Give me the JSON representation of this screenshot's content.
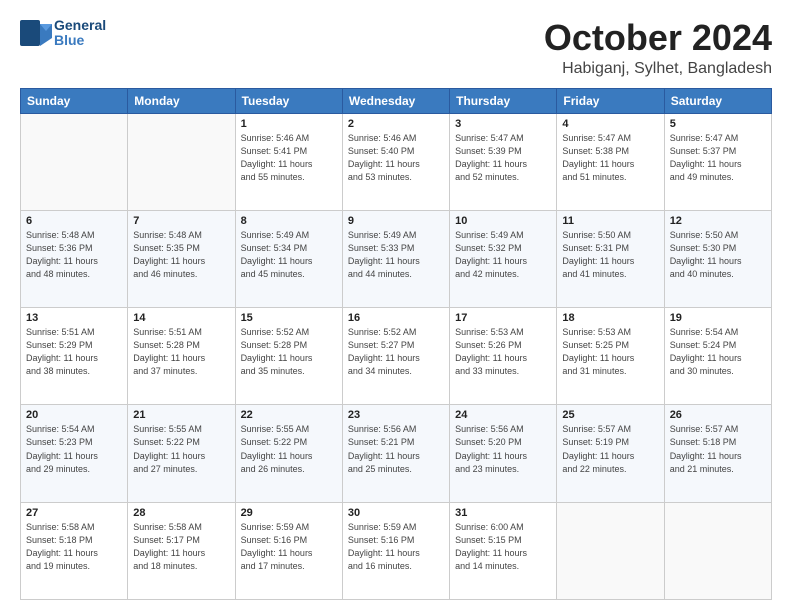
{
  "header": {
    "logo_general": "General",
    "logo_blue": "Blue",
    "month": "October 2024",
    "location": "Habiganj, Sylhet, Bangladesh"
  },
  "weekdays": [
    "Sunday",
    "Monday",
    "Tuesday",
    "Wednesday",
    "Thursday",
    "Friday",
    "Saturday"
  ],
  "weeks": [
    [
      {
        "day": "",
        "info": ""
      },
      {
        "day": "",
        "info": ""
      },
      {
        "day": "1",
        "info": "Sunrise: 5:46 AM\nSunset: 5:41 PM\nDaylight: 11 hours\nand 55 minutes."
      },
      {
        "day": "2",
        "info": "Sunrise: 5:46 AM\nSunset: 5:40 PM\nDaylight: 11 hours\nand 53 minutes."
      },
      {
        "day": "3",
        "info": "Sunrise: 5:47 AM\nSunset: 5:39 PM\nDaylight: 11 hours\nand 52 minutes."
      },
      {
        "day": "4",
        "info": "Sunrise: 5:47 AM\nSunset: 5:38 PM\nDaylight: 11 hours\nand 51 minutes."
      },
      {
        "day": "5",
        "info": "Sunrise: 5:47 AM\nSunset: 5:37 PM\nDaylight: 11 hours\nand 49 minutes."
      }
    ],
    [
      {
        "day": "6",
        "info": "Sunrise: 5:48 AM\nSunset: 5:36 PM\nDaylight: 11 hours\nand 48 minutes."
      },
      {
        "day": "7",
        "info": "Sunrise: 5:48 AM\nSunset: 5:35 PM\nDaylight: 11 hours\nand 46 minutes."
      },
      {
        "day": "8",
        "info": "Sunrise: 5:49 AM\nSunset: 5:34 PM\nDaylight: 11 hours\nand 45 minutes."
      },
      {
        "day": "9",
        "info": "Sunrise: 5:49 AM\nSunset: 5:33 PM\nDaylight: 11 hours\nand 44 minutes."
      },
      {
        "day": "10",
        "info": "Sunrise: 5:49 AM\nSunset: 5:32 PM\nDaylight: 11 hours\nand 42 minutes."
      },
      {
        "day": "11",
        "info": "Sunrise: 5:50 AM\nSunset: 5:31 PM\nDaylight: 11 hours\nand 41 minutes."
      },
      {
        "day": "12",
        "info": "Sunrise: 5:50 AM\nSunset: 5:30 PM\nDaylight: 11 hours\nand 40 minutes."
      }
    ],
    [
      {
        "day": "13",
        "info": "Sunrise: 5:51 AM\nSunset: 5:29 PM\nDaylight: 11 hours\nand 38 minutes."
      },
      {
        "day": "14",
        "info": "Sunrise: 5:51 AM\nSunset: 5:28 PM\nDaylight: 11 hours\nand 37 minutes."
      },
      {
        "day": "15",
        "info": "Sunrise: 5:52 AM\nSunset: 5:28 PM\nDaylight: 11 hours\nand 35 minutes."
      },
      {
        "day": "16",
        "info": "Sunrise: 5:52 AM\nSunset: 5:27 PM\nDaylight: 11 hours\nand 34 minutes."
      },
      {
        "day": "17",
        "info": "Sunrise: 5:53 AM\nSunset: 5:26 PM\nDaylight: 11 hours\nand 33 minutes."
      },
      {
        "day": "18",
        "info": "Sunrise: 5:53 AM\nSunset: 5:25 PM\nDaylight: 11 hours\nand 31 minutes."
      },
      {
        "day": "19",
        "info": "Sunrise: 5:54 AM\nSunset: 5:24 PM\nDaylight: 11 hours\nand 30 minutes."
      }
    ],
    [
      {
        "day": "20",
        "info": "Sunrise: 5:54 AM\nSunset: 5:23 PM\nDaylight: 11 hours\nand 29 minutes."
      },
      {
        "day": "21",
        "info": "Sunrise: 5:55 AM\nSunset: 5:22 PM\nDaylight: 11 hours\nand 27 minutes."
      },
      {
        "day": "22",
        "info": "Sunrise: 5:55 AM\nSunset: 5:22 PM\nDaylight: 11 hours\nand 26 minutes."
      },
      {
        "day": "23",
        "info": "Sunrise: 5:56 AM\nSunset: 5:21 PM\nDaylight: 11 hours\nand 25 minutes."
      },
      {
        "day": "24",
        "info": "Sunrise: 5:56 AM\nSunset: 5:20 PM\nDaylight: 11 hours\nand 23 minutes."
      },
      {
        "day": "25",
        "info": "Sunrise: 5:57 AM\nSunset: 5:19 PM\nDaylight: 11 hours\nand 22 minutes."
      },
      {
        "day": "26",
        "info": "Sunrise: 5:57 AM\nSunset: 5:18 PM\nDaylight: 11 hours\nand 21 minutes."
      }
    ],
    [
      {
        "day": "27",
        "info": "Sunrise: 5:58 AM\nSunset: 5:18 PM\nDaylight: 11 hours\nand 19 minutes."
      },
      {
        "day": "28",
        "info": "Sunrise: 5:58 AM\nSunset: 5:17 PM\nDaylight: 11 hours\nand 18 minutes."
      },
      {
        "day": "29",
        "info": "Sunrise: 5:59 AM\nSunset: 5:16 PM\nDaylight: 11 hours\nand 17 minutes."
      },
      {
        "day": "30",
        "info": "Sunrise: 5:59 AM\nSunset: 5:16 PM\nDaylight: 11 hours\nand 16 minutes."
      },
      {
        "day": "31",
        "info": "Sunrise: 6:00 AM\nSunset: 5:15 PM\nDaylight: 11 hours\nand 14 minutes."
      },
      {
        "day": "",
        "info": ""
      },
      {
        "day": "",
        "info": ""
      }
    ]
  ]
}
